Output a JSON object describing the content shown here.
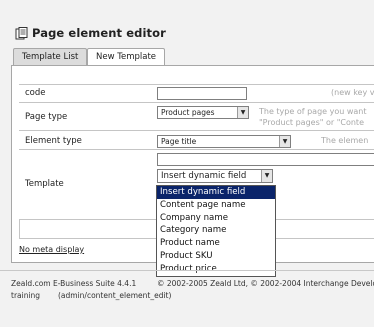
{
  "header": {
    "title": "Page element editor",
    "icon": "document-icon"
  },
  "tabs": [
    {
      "label": "Template List",
      "active": false
    },
    {
      "label": "New Template",
      "active": true
    }
  ],
  "form": {
    "code": {
      "label": "code",
      "value": "",
      "hint": "(new key v"
    },
    "page_type": {
      "label": "Page type",
      "value": "Product pages",
      "hint_line1": "The type of page you want",
      "hint_line2": "\"Product pages\" or \"Conte"
    },
    "element_type": {
      "label": "Element type",
      "value": "Page title",
      "hint": "The elemen"
    },
    "template": {
      "label": "Template",
      "value": "",
      "select_value": "Insert dynamic field"
    }
  },
  "dropdown": {
    "items": [
      "Insert dynamic field",
      "Content page name",
      "Company name",
      "Category name",
      "Product name",
      "Product SKU",
      "Product price"
    ],
    "selected_index": 0
  },
  "bottom_link": "No meta display",
  "footer": {
    "product": "Zeald.com E-Business Suite 4.4.1",
    "copyright": "© 2002-2005 Zeald Ltd, © 2002-2004 Interchange Develo",
    "mode": "training",
    "path": "(admin/content_element_edit)"
  }
}
